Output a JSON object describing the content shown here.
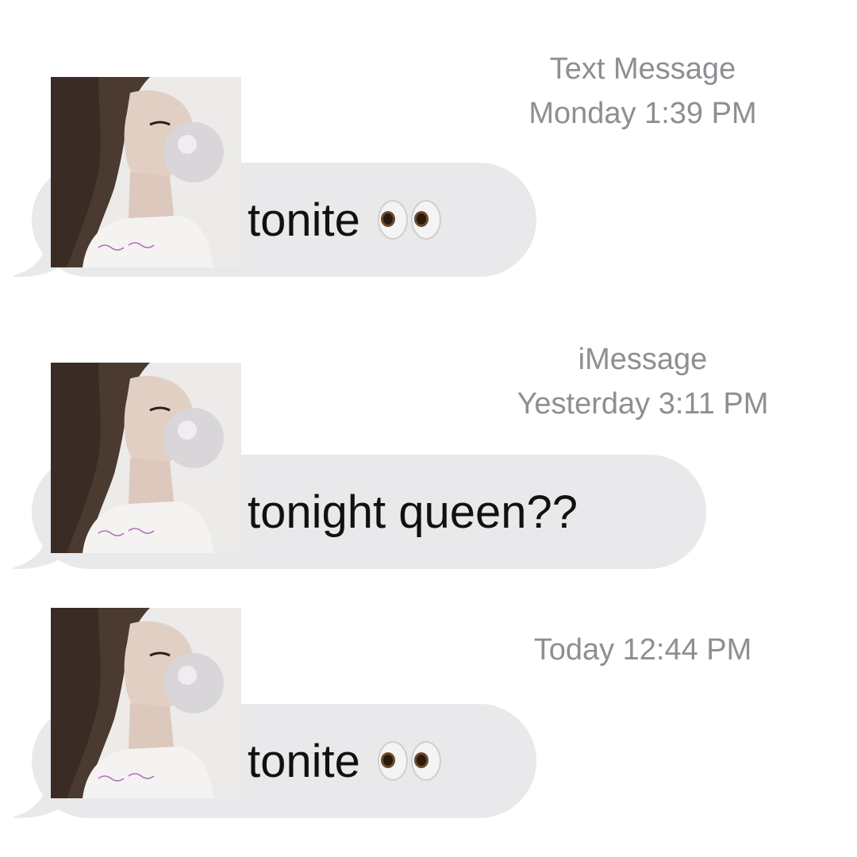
{
  "messages": [
    {
      "service": "Text Message",
      "timestamp": "Monday 1:39 PM",
      "text": "tonite",
      "emoji_icon": "eyes-emoji-icon"
    },
    {
      "service": "iMessage",
      "timestamp": "Yesterday 3:11 PM",
      "text": "tonight queen??",
      "emoji_icon": ""
    },
    {
      "service": "",
      "timestamp": "Today 12:44 PM",
      "text": "tonite",
      "emoji_icon": "eyes-emoji-icon"
    }
  ],
  "colors": {
    "bubble": "#e9e9eb",
    "timestamp": "#8e8e93",
    "text": "#111111",
    "background": "#ffffff"
  }
}
